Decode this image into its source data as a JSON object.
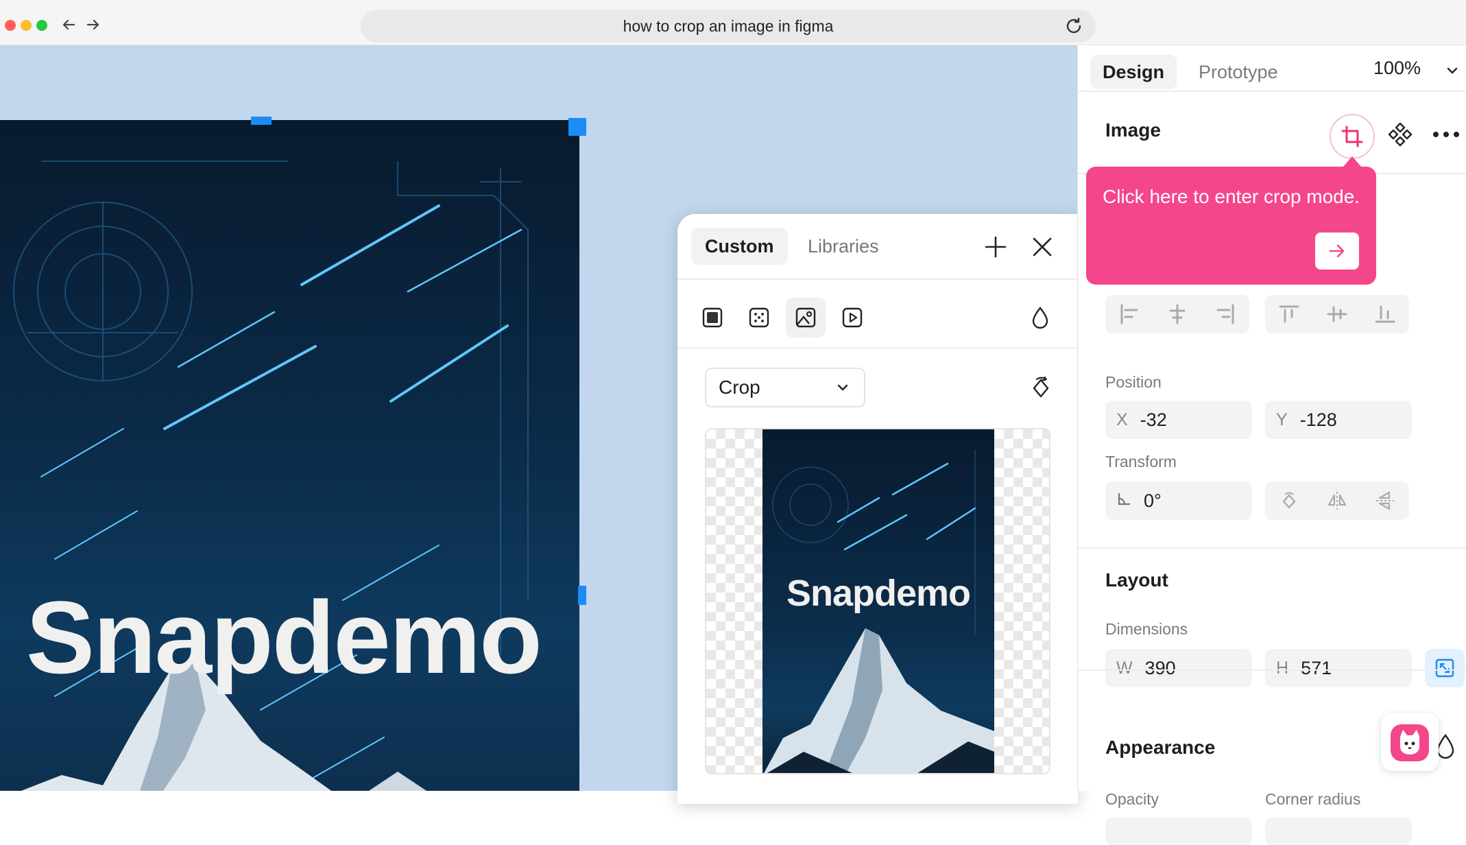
{
  "browser": {
    "address": "how to crop an image in figma",
    "traffic_lights": [
      "#ff5f57",
      "#febc2e",
      "#28c840"
    ]
  },
  "canvas": {
    "background": "#c2d7ee",
    "artwork_title": "Snapdemo",
    "selection_color": "#1b8cf5"
  },
  "panel": {
    "tabs": [
      "Design",
      "Prototype"
    ],
    "zoom": "100%",
    "image_section_title": "Image",
    "position_label": "Position",
    "x_prefix": "X",
    "x_value": "-32",
    "y_prefix": "Y",
    "y_value": "-128",
    "transform_label": "Transform",
    "rotation_value": "0°",
    "layout_title": "Layout",
    "dimensions_label": "Dimensions",
    "w_prefix": "W",
    "w_value": "390",
    "h_prefix": "H",
    "h_value": "571",
    "appearance_title": "Appearance",
    "opacity_label": "Opacity",
    "corner_radius_label": "Corner radius"
  },
  "tooltip": {
    "text": "Click here to enter crop mode.",
    "color": "#f4468a"
  },
  "fill_popup": {
    "tabs": [
      "Custom",
      "Libraries"
    ],
    "mode": "Crop",
    "preview_title": "Snapdemo"
  }
}
